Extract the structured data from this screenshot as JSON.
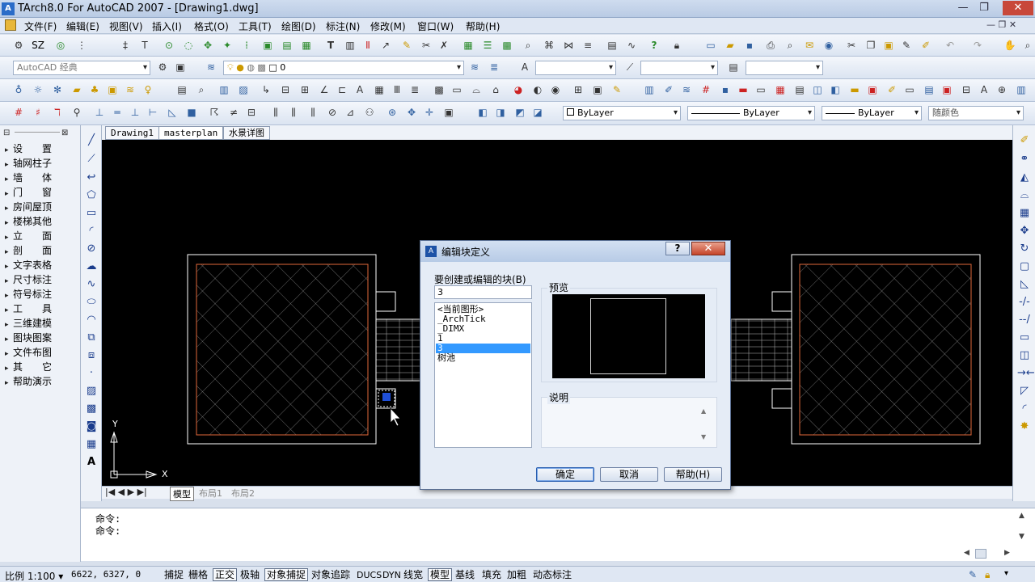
{
  "window": {
    "title": "TArch8.0 For AutoCAD 2007 - [Drawing1.dwg]",
    "app_icon": "A",
    "minimize_glyph": "—",
    "restore_glyph": "❐",
    "close_glyph": "✕"
  },
  "menu": [
    "文件(F)",
    "编辑(E)",
    "视图(V)",
    "插入(I)",
    "格式(O)",
    "工具(T)",
    "绘图(D)",
    "标注(N)",
    "修改(M)",
    "窗口(W)",
    "帮助(H)"
  ],
  "toolbar": {
    "sz_label": "SZ",
    "workspace_value": "AutoCAD 经典",
    "layer_value": "0",
    "color_value": "ByLayer",
    "linetype_value": "ByLayer",
    "lineweight_value": "ByLayer",
    "plotstyle_value": "随颜色"
  },
  "left_panel": {
    "items": [
      "设　　置",
      "轴网柱子",
      "墙　　体",
      "门　　窗",
      "房间屋顶",
      "楼梯其他",
      "立　　面",
      "剖　　面",
      "文字表格",
      "尺寸标注",
      "符号标注",
      "工　　具",
      "三维建模",
      "图块图案",
      "文件布图",
      "其　　它",
      "帮助演示"
    ]
  },
  "doc_tabs": [
    "Drawing1",
    "masterplan",
    "水景详图"
  ],
  "canvas": {
    "axis_y": "Y",
    "axis_x": "X",
    "bg_color": "#000000",
    "frame_color": "#ffffff",
    "inner_color": "#e0683a"
  },
  "layout_tabs": [
    "模型",
    "布局1",
    "布局2"
  ],
  "command": {
    "lines": [
      "命令:",
      "命令:"
    ]
  },
  "status": {
    "scale": "比例 1:100",
    "coords": "6622, 6327, 0",
    "toggles": [
      {
        "label": "捕捉",
        "on": false
      },
      {
        "label": "栅格",
        "on": false
      },
      {
        "label": "正交",
        "on": true
      },
      {
        "label": "极轴",
        "on": false
      },
      {
        "label": "对象捕捉",
        "on": true
      },
      {
        "label": "对象追踪",
        "on": false
      },
      {
        "label": "DUCS",
        "on": false
      },
      {
        "label": "DYN",
        "on": false
      },
      {
        "label": "线宽",
        "on": false
      },
      {
        "label": "模型",
        "on": true
      },
      {
        "label": "基线",
        "on": false
      },
      {
        "label": "填充",
        "on": false
      },
      {
        "label": "加粗",
        "on": false
      },
      {
        "label": "动态标注",
        "on": false
      }
    ]
  },
  "dialog": {
    "title": "编辑块定义",
    "help_glyph": "?",
    "close_glyph": "✕",
    "prompt": "要创建或编辑的块(B)",
    "name_value": "3",
    "list_items": [
      "<当前图形>",
      "_ArchTick",
      "_DIMX",
      "1",
      "3",
      "树池"
    ],
    "selected_index": 4,
    "preview_label": "预览",
    "description_label": "说明",
    "ok_label": "确定",
    "cancel_label": "取消",
    "help_label": "帮助(H)"
  }
}
